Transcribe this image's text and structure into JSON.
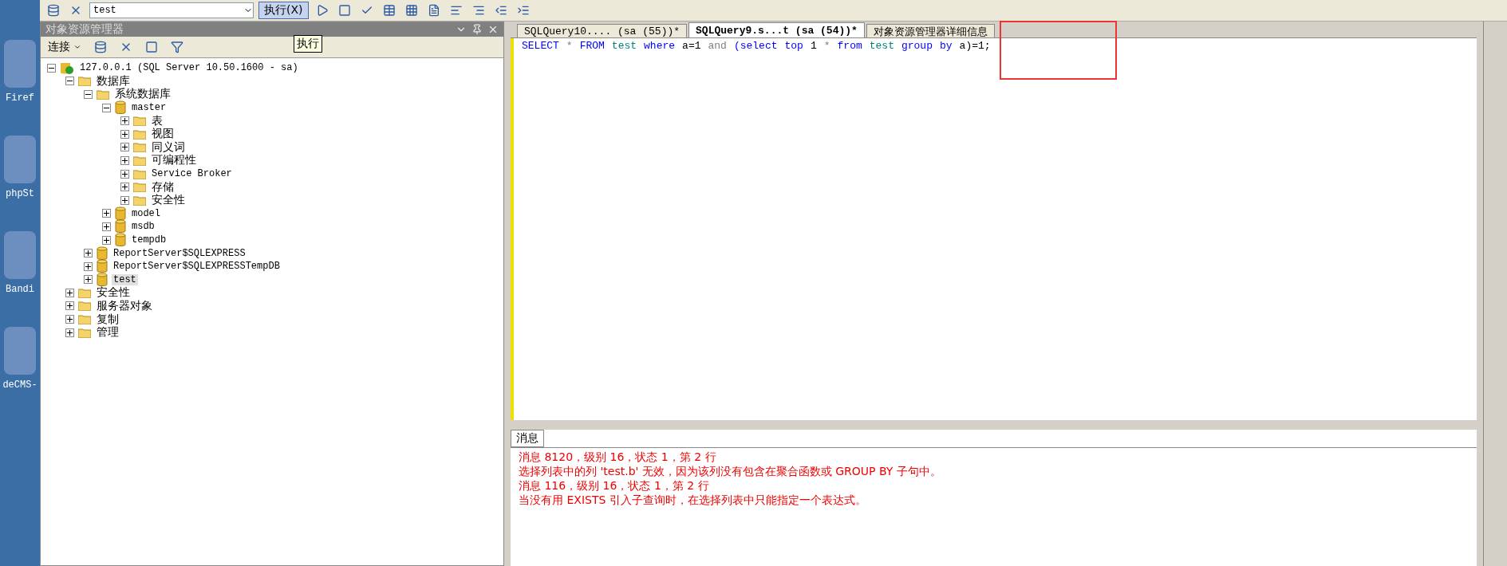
{
  "desktop": {
    "icons": [
      {
        "label": "Firef"
      },
      {
        "label": "phpSt"
      },
      {
        "label": "Bandi"
      },
      {
        "label": "deCMS-"
      }
    ]
  },
  "toolbar": {
    "database": "test",
    "execute": "执行(X)",
    "tooltip": "执行"
  },
  "object_explorer": {
    "title": "对象资源管理器",
    "connect": "连接",
    "tree": [
      {
        "label": "127.0.0.1 (SQL Server 10.50.1600 - sa)",
        "kind": "server",
        "expanded": true,
        "selected": false,
        "children": [
          {
            "label": "数据库",
            "kind": "folder",
            "expanded": true,
            "selected": false,
            "children": [
              {
                "label": "系统数据库",
                "kind": "folder",
                "expanded": true,
                "selected": false,
                "children": [
                  {
                    "label": "master",
                    "kind": "db",
                    "expanded": true,
                    "selected": false,
                    "children": [
                      {
                        "label": "表",
                        "kind": "folder",
                        "expanded": false,
                        "selected": false
                      },
                      {
                        "label": "视图",
                        "kind": "folder",
                        "expanded": false,
                        "selected": false
                      },
                      {
                        "label": "同义词",
                        "kind": "folder",
                        "expanded": false,
                        "selected": false
                      },
                      {
                        "label": "可编程性",
                        "kind": "folder",
                        "expanded": false,
                        "selected": false
                      },
                      {
                        "label": "Service Broker",
                        "kind": "folder",
                        "expanded": false,
                        "selected": false
                      },
                      {
                        "label": "存储",
                        "kind": "folder",
                        "expanded": false,
                        "selected": false
                      },
                      {
                        "label": "安全性",
                        "kind": "folder",
                        "expanded": false,
                        "selected": false
                      }
                    ]
                  },
                  {
                    "label": "model",
                    "kind": "db",
                    "expanded": false,
                    "selected": false
                  },
                  {
                    "label": "msdb",
                    "kind": "db",
                    "expanded": false,
                    "selected": false
                  },
                  {
                    "label": "tempdb",
                    "kind": "db",
                    "expanded": false,
                    "selected": false
                  }
                ]
              },
              {
                "label": "ReportServer$SQLEXPRESS",
                "kind": "db",
                "expanded": false,
                "selected": false
              },
              {
                "label": "ReportServer$SQLEXPRESSTempDB",
                "kind": "db",
                "expanded": false,
                "selected": false
              },
              {
                "label": "test",
                "kind": "db",
                "expanded": false,
                "selected": true
              }
            ]
          },
          {
            "label": "安全性",
            "kind": "folder",
            "expanded": false,
            "selected": false
          },
          {
            "label": "服务器对象",
            "kind": "folder",
            "expanded": false,
            "selected": false
          },
          {
            "label": "复制",
            "kind": "folder",
            "expanded": false,
            "selected": false
          },
          {
            "label": "管理",
            "kind": "folder",
            "expanded": false,
            "selected": false
          }
        ]
      }
    ]
  },
  "editor": {
    "tabs": [
      {
        "label": "SQLQuery10.... (sa (55))*",
        "selected": false
      },
      {
        "label": "SQLQuery9.s...t (sa (54))*",
        "selected": true
      },
      {
        "label": "对象资源管理器详细信息",
        "selected": false
      }
    ],
    "query": [
      {
        "text": "SELECT",
        "kind": "keyword"
      },
      {
        "text": "*",
        "kind": "op"
      },
      {
        "text": "FROM",
        "kind": "keyword"
      },
      {
        "text": "test",
        "kind": "ident"
      },
      {
        "text": "where",
        "kind": "keyword"
      },
      {
        "text": "a=1",
        "kind": "plain"
      },
      {
        "text": "and",
        "kind": "op"
      },
      {
        "text": "(select",
        "kind": "keyword"
      },
      {
        "text": "top",
        "kind": "keyword"
      },
      {
        "text": "1",
        "kind": "plain"
      },
      {
        "text": "*",
        "kind": "op"
      },
      {
        "text": "from",
        "kind": "keyword"
      },
      {
        "text": "test",
        "kind": "ident"
      },
      {
        "text": "group",
        "kind": "keyword"
      },
      {
        "text": "by",
        "kind": "keyword"
      },
      {
        "text": "a)=1;",
        "kind": "plain"
      }
    ]
  },
  "messages": {
    "tab": "消息",
    "lines": [
      "消息 8120，级别 16，状态 1，第 2 行",
      "选择列表中的列 'test.b' 无效，因为该列没有包含在聚合函数或 GROUP BY 子句中。",
      "消息 116，级别 16，状态 1，第 2 行",
      "当没有用 EXISTS 引入子查询时，在选择列表中只能指定一个表达式。"
    ]
  }
}
